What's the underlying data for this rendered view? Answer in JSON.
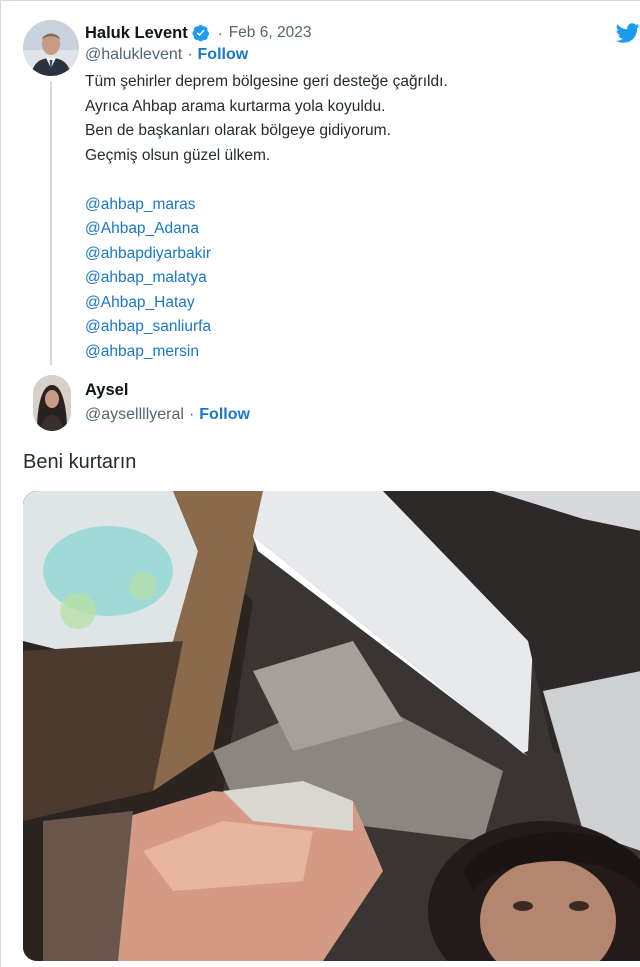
{
  "tweet": {
    "author_name": "Haluk Levent",
    "date": "Feb 6, 2023",
    "handle": "@haluklevent",
    "follow_label": "Follow",
    "lines": [
      "Tüm şehirler deprem bölgesine geri desteğe çağrıldı.",
      "Ayrıca Ahbap arama kurtarma yola koyuldu.",
      "Ben de başkanları olarak bölgeye gidiyorum.",
      "Geçmiş olsun güzel ülkem."
    ],
    "mentions": [
      "@ahbap_maras",
      "@Ahbap_Adana",
      "@ahbapdiyarbakir",
      "@ahbap_malatya",
      "@Ahbap_Hatay",
      "@ahbap_sanliurfa",
      "@ahbap_mersin"
    ]
  },
  "reply": {
    "author_name": "Aysel",
    "handle": "@aysellllyeral",
    "follow_label": "Follow",
    "text": "Beni kurtarın"
  },
  "colors": {
    "link": "#1877c9",
    "verified": "#1d9bf0",
    "twitter_brand": "#1d9bf0",
    "secondary_text": "#536471"
  },
  "icons": {
    "logo": "twitter-bird-icon",
    "verified": "verified-badge-icon"
  }
}
